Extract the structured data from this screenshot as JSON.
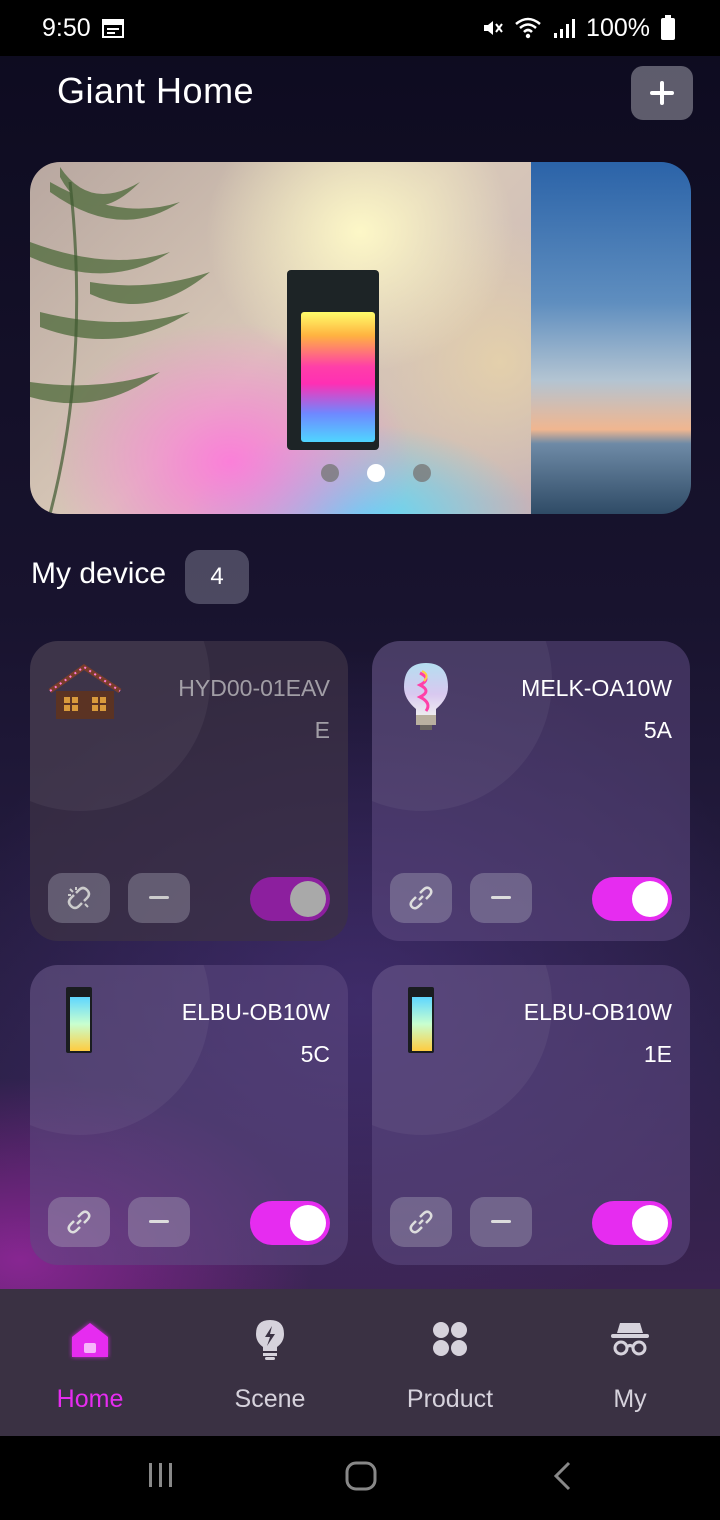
{
  "status_bar": {
    "time": "9:50",
    "battery": "100%"
  },
  "header": {
    "title": "Giant Home",
    "add_icon": "plus-icon"
  },
  "banner": {
    "slide_count": 3,
    "active_slide": 2
  },
  "devices_section": {
    "title": "My device",
    "count": "4"
  },
  "devices": [
    {
      "name_line1": "HYD00-01EAV",
      "name_line2": "E",
      "icon": "house-lights-icon",
      "online": false,
      "power_on": true
    },
    {
      "name_line1": "MELK-OA10W",
      "name_line2": "5A",
      "icon": "bulb-icon",
      "online": true,
      "power_on": true
    },
    {
      "name_line1": "ELBU-OB10W",
      "name_line2": "5C",
      "icon": "wall-lamp-icon",
      "online": true,
      "power_on": true
    },
    {
      "name_line1": "ELBU-OB10W",
      "name_line2": "1E",
      "icon": "wall-lamp-icon",
      "online": true,
      "power_on": true
    }
  ],
  "bottom_nav": {
    "items": [
      {
        "label": "Home",
        "icon": "home-icon",
        "active": true
      },
      {
        "label": "Scene",
        "icon": "scene-bulb-icon",
        "active": false
      },
      {
        "label": "Product",
        "icon": "product-grid-icon",
        "active": false
      },
      {
        "label": "My",
        "icon": "profile-spy-icon",
        "active": false
      }
    ]
  },
  "colors": {
    "accent": "#e62cf0",
    "nav_background": "#3a3143"
  }
}
